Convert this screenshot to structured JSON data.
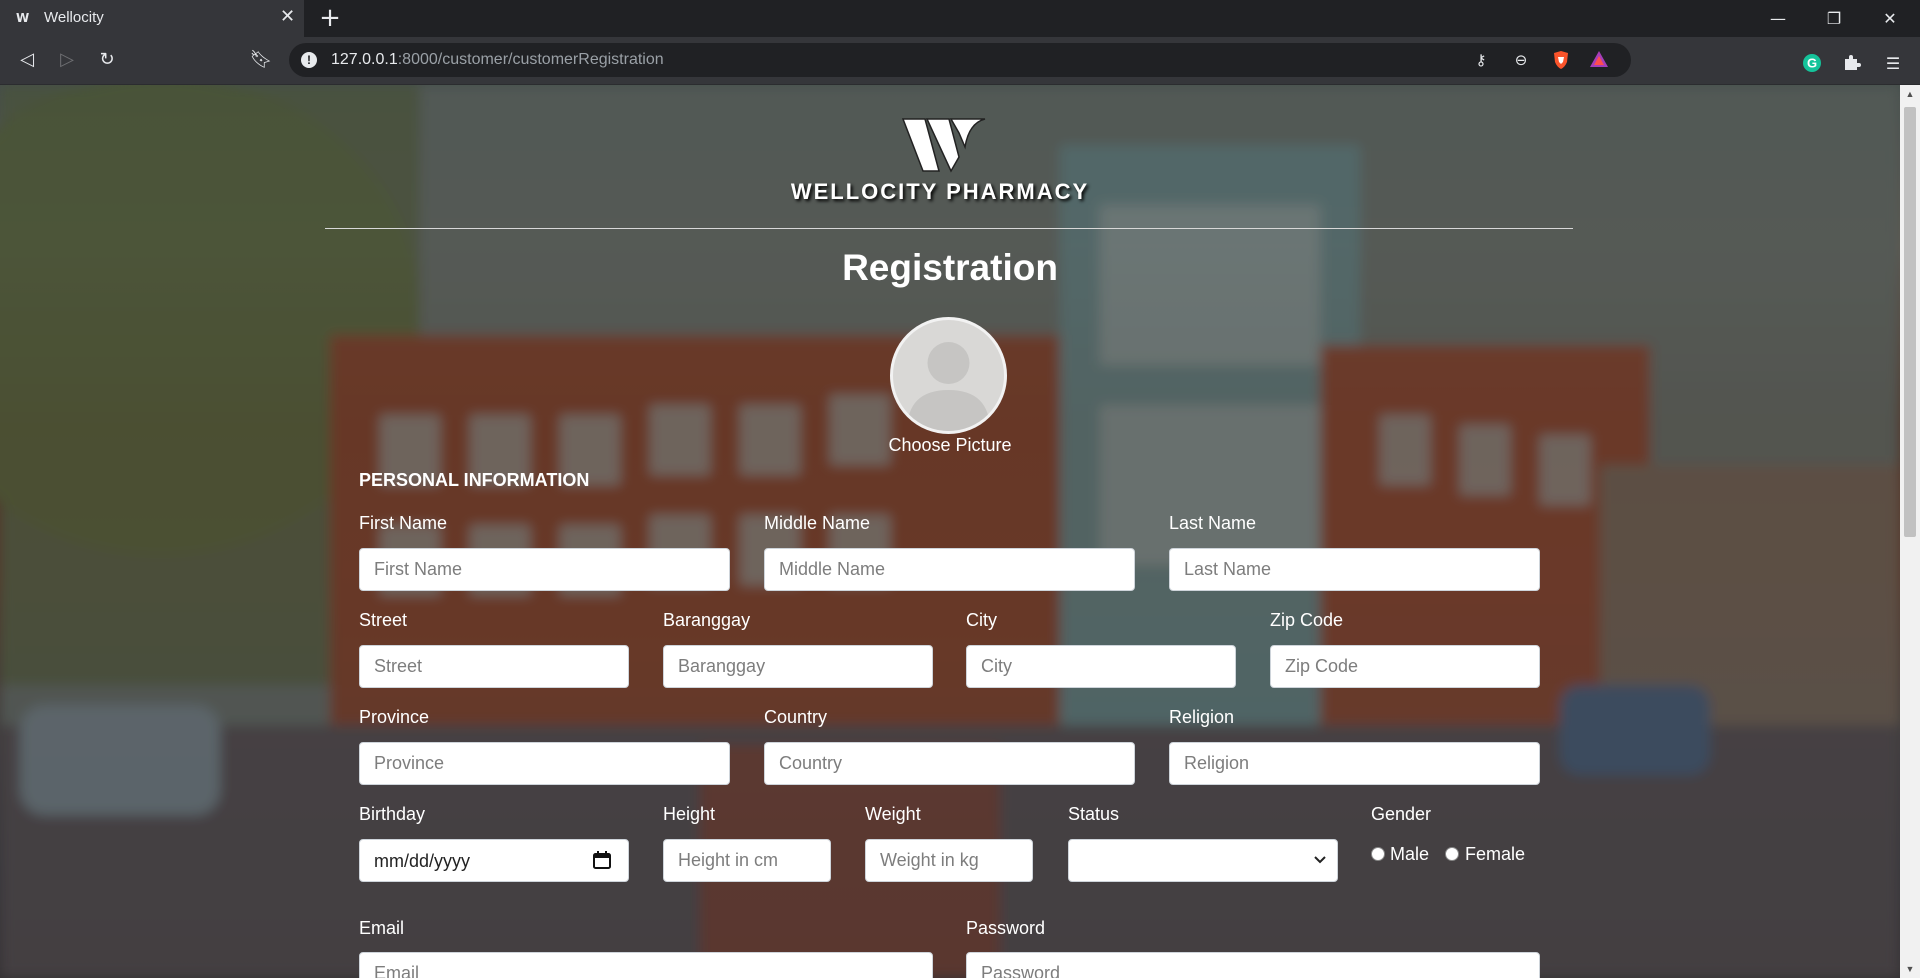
{
  "browser": {
    "tab_title": "Wellocity",
    "url_host": "127.0.0.1",
    "url_path": ":8000/customer/customerRegistration"
  },
  "page": {
    "brand": "WELLOCITY PHARMACY",
    "heading": "Registration",
    "choose_picture": "Choose Picture",
    "section_title": "PERSONAL INFORMATION"
  },
  "form": {
    "first_name": {
      "label": "First Name",
      "placeholder": "First Name"
    },
    "middle_name": {
      "label": "Middle Name",
      "placeholder": "Middle Name"
    },
    "last_name": {
      "label": "Last Name",
      "placeholder": "Last Name"
    },
    "street": {
      "label": "Street",
      "placeholder": "Street"
    },
    "barangay": {
      "label": "Baranggay",
      "placeholder": "Baranggay"
    },
    "city": {
      "label": "City",
      "placeholder": "City"
    },
    "zip": {
      "label": "Zip Code",
      "placeholder": "Zip Code"
    },
    "province": {
      "label": "Province",
      "placeholder": "Province"
    },
    "country": {
      "label": "Country",
      "placeholder": "Country"
    },
    "religion": {
      "label": "Religion",
      "placeholder": "Religion"
    },
    "birthday": {
      "label": "Birthday",
      "value": "mm/dd/yyyy"
    },
    "height": {
      "label": "Height",
      "placeholder": "Height in cm"
    },
    "weight": {
      "label": "Weight",
      "placeholder": "Weight in kg"
    },
    "status": {
      "label": "Status",
      "value": ""
    },
    "gender": {
      "label": "Gender",
      "options": [
        "Male",
        "Female"
      ]
    },
    "email": {
      "label": "Email",
      "placeholder": "Email"
    },
    "password": {
      "label": "Password",
      "placeholder": "Password"
    }
  },
  "colors": {
    "chrome_dark": "#202124",
    "chrome_mid": "#35363a",
    "text_white": "#ffffff"
  }
}
